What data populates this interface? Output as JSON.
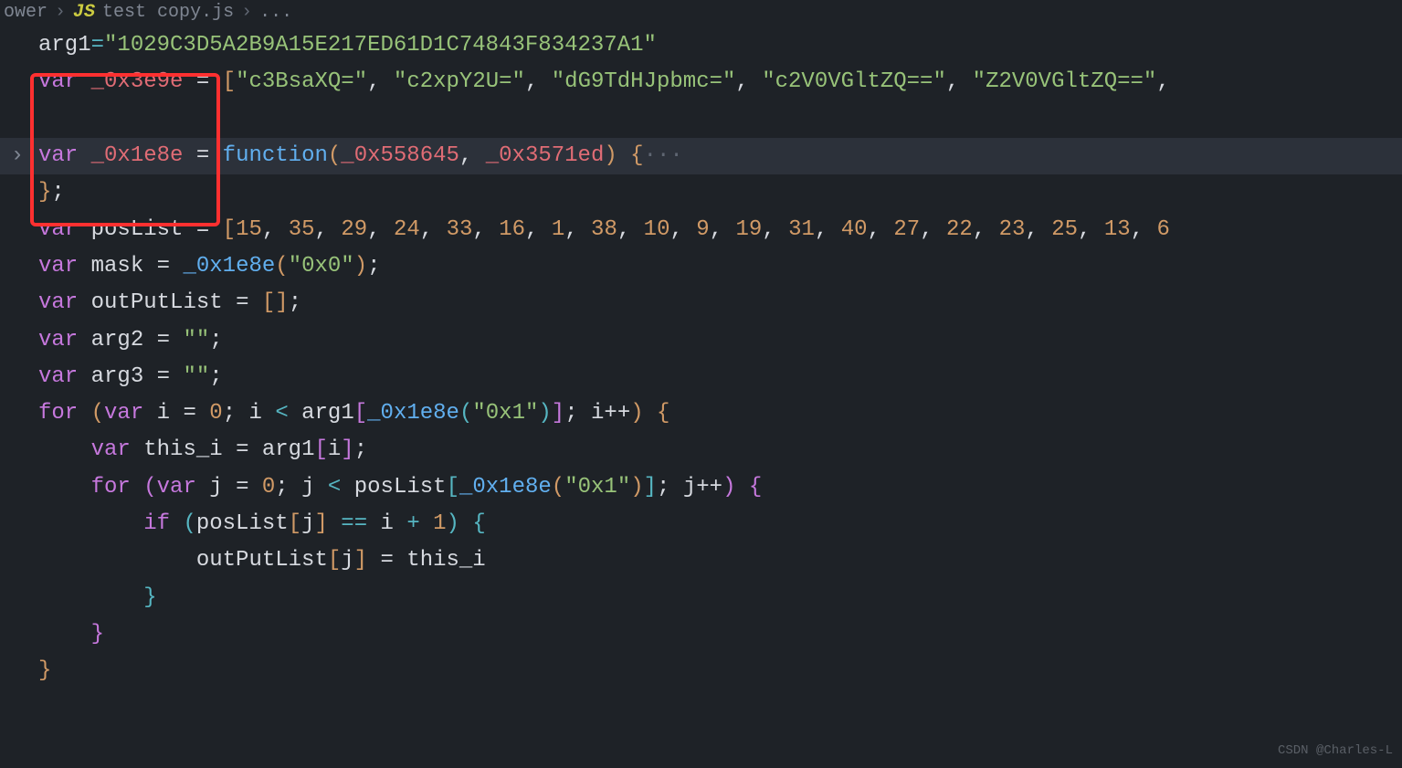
{
  "breadcrumb": {
    "folder": "ower",
    "file": "test copy.js",
    "tail": "..."
  },
  "code": {
    "l1": {
      "arg1": "arg1",
      "eq": "=",
      "val": "\"1029C3D5A2B9A15E217ED61D1C74843F834237A1\""
    },
    "l2": {
      "kw": "var",
      "id": "_0x3e9e",
      "eq": "=",
      "ob": "[",
      "s0": "\"c3BsaXQ=\"",
      "s1": "\"c2xpY2U=\"",
      "s2": "\"dG9TdHJpbmc=\"",
      "s3": "\"c2V0VGltZQ==\"",
      "s4": "\"Z2V0VGltZQ==\"",
      "c": ","
    },
    "l4": {
      "kw": "var",
      "id": "_0x1e8e",
      "eq": "=",
      "fn": "function",
      "p1": "_0x558645",
      "p2": "_0x3571ed",
      "ob": "(",
      "cb": ")",
      "bro": "{",
      "dots": "···"
    },
    "l5": {
      "brc": "}",
      "semi": ";"
    },
    "l6": {
      "kw": "var",
      "id": "posList",
      "eq": "=",
      "ob": "[",
      "nums": [
        "15",
        "35",
        "29",
        "24",
        "33",
        "16",
        "1",
        "38",
        "10",
        "9",
        "19",
        "31",
        "40",
        "27",
        "22",
        "23",
        "25",
        "13",
        "6"
      ],
      "c": ","
    },
    "l7": {
      "kw": "var",
      "id": "mask",
      "eq": "=",
      "fn": "_0x1e8e",
      "arg": "\"0x0\"",
      "semi": ";"
    },
    "l8": {
      "kw": "var",
      "id": "outPutList",
      "eq": "=",
      "ob": "[",
      "cb": "]",
      "semi": ";"
    },
    "l9": {
      "kw": "var",
      "id": "arg2",
      "eq": "=",
      "val": "\"\"",
      "semi": ";"
    },
    "l10": {
      "kw": "var",
      "id": "arg3",
      "eq": "=",
      "val": "\"\"",
      "semi": ";"
    },
    "l11": {
      "for": "for",
      "var": "var",
      "i": "i",
      "z": "0",
      "lt": "<",
      "arg1": "arg1",
      "fn": "_0x1e8e",
      "arg": "\"0x1\"",
      "ipp": "i++",
      "semi": ";"
    },
    "l12": {
      "var": "var",
      "id": "this_i",
      "eq": "=",
      "arg1": "arg1",
      "i": "i",
      "semi": ";"
    },
    "l13": {
      "for": "for",
      "var": "var",
      "j": "j",
      "z": "0",
      "lt": "<",
      "pl": "posList",
      "fn": "_0x1e8e",
      "arg": "\"0x1\"",
      "jpp": "j++",
      "semi": ";"
    },
    "l14": {
      "if": "if",
      "pl": "posList",
      "j": "j",
      "dd": "==",
      "i": "i",
      "pl1": "+",
      "one": "1"
    },
    "l15": {
      "opl": "outPutList",
      "j": "j",
      "eq": "=",
      "ti": "this_i"
    },
    "l16": {
      "brc": "}"
    },
    "l17": {
      "brc": "}"
    },
    "l18": {
      "brc": "}"
    },
    "l19": {
      "brc": "}"
    }
  },
  "watermark": "CSDN @Charles-L"
}
